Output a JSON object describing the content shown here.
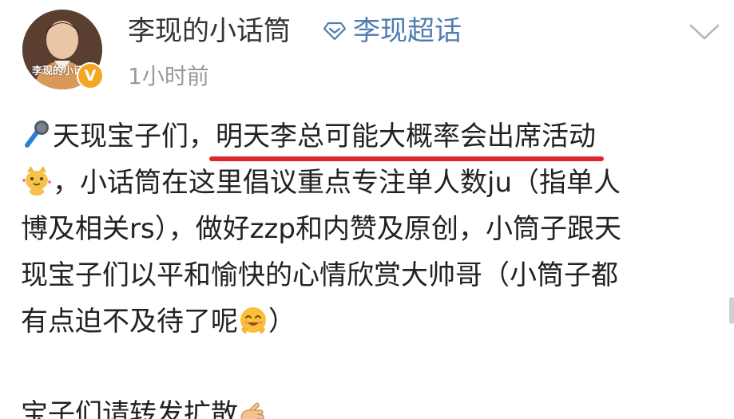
{
  "header": {
    "user_name": "李现的小话筒",
    "avatar_caption": "李现的小话",
    "verified_mark": "V",
    "topic_label": "李现超话",
    "timestamp": "1小时前"
  },
  "icons": {
    "topic": "diamond-topic-icon",
    "menu": "chevron-down-icon",
    "microphone": "microphone-emoji",
    "cat": "cat-emoji",
    "smile": "smiling-emoji",
    "hand": "pointing-hand-emoji"
  },
  "colors": {
    "accent_link": "#507daf",
    "underline": "#e0242b",
    "verified": "#f5a623",
    "text": "#222222",
    "muted": "#9a9a9a"
  },
  "post": {
    "line1_a": "天现宝子们，",
    "line1_highlight": "明天李总可能大概率会出席活动",
    "line2": "，小话筒在这里倡议重点专注单人数ju（指单人",
    "line3": "博及相关rs），做好zzp和内赞及原创，小筒子跟天",
    "line4": "现宝子们以平和愉快的心情欣赏大帅哥（小筒子都",
    "line5_a": "有点迫不及待了呢",
    "line5_b": "）",
    "line7": "宝子们请转发扩散"
  }
}
